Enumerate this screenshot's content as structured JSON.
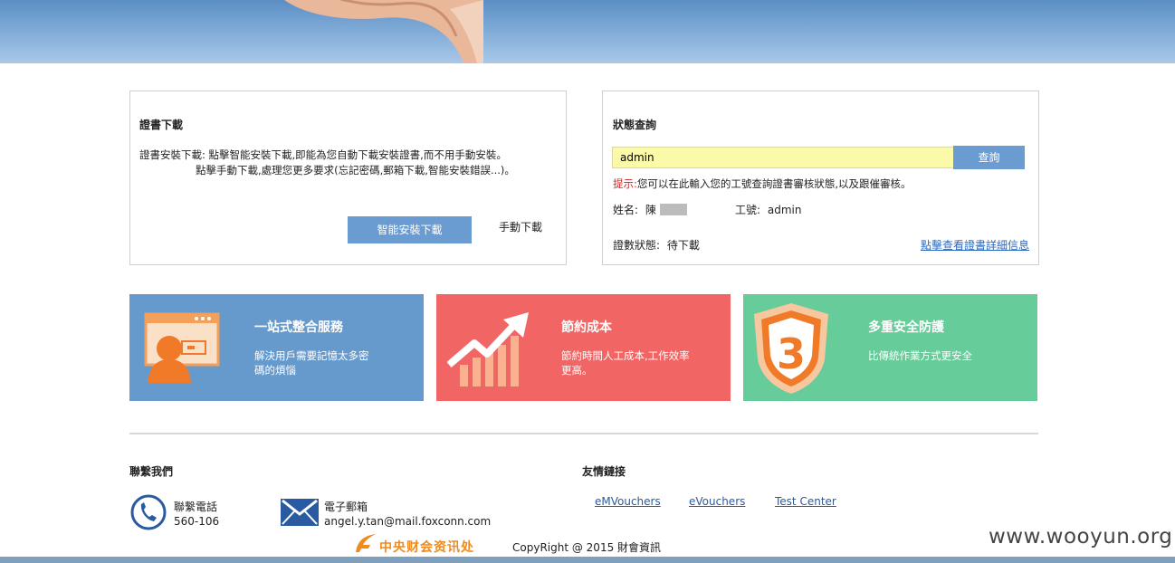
{
  "cert_download": {
    "title": "證書下載",
    "desc_line1": "證書安裝下載: 點擊智能安裝下載,即能為您自動下載安裝證書,而不用手動安裝。",
    "desc_line2": "點擊手動下載,處理您更多要求(忘記密碼,郵箱下載,智能安裝錯誤...)。",
    "smart_button": "智能安裝下載",
    "manual_link": "手動下載"
  },
  "status_query": {
    "title": "狀態查詢",
    "input_value": "admin",
    "query_button": "查詢",
    "tip_label": "提示:",
    "tip_text": "您可以在此輸入您的工號查詢證書審核狀態,以及跟催審核。",
    "name_label": "姓名:",
    "name_value": "陳",
    "empno_label": "工號:",
    "empno_value": "admin",
    "status_label": "證數狀態:",
    "status_value": "待下載",
    "detail_link": "點擊查看證書詳細信息"
  },
  "tiles": [
    {
      "title": "一站式整合服務",
      "desc": "解決用戶需要記憶太多密碼的煩惱",
      "color": "#6699cc",
      "icon": "user-screen-icon"
    },
    {
      "title": "節約成本",
      "desc": "節約時間人工成本,工作效率更高。",
      "color": "#f26565",
      "icon": "growth-chart-icon"
    },
    {
      "title": "多重安全防護",
      "desc": "比傳統作業方式更安全",
      "color": "#66cc99",
      "icon": "shield-3-icon"
    }
  ],
  "footer": {
    "contact_title": "聯繫我們",
    "phone_label": "聯繫電話",
    "phone_value": "560-106",
    "email_label": "電子郵箱",
    "email_value": "angel.y.tan@mail.foxconn.com",
    "links_title": "友情鏈接",
    "links": [
      "eMVouchers",
      "eVouchers",
      "Test Center"
    ],
    "logo_text": "中央财会资讯处",
    "copyright": "CopyRight @ 2015 財會資訊"
  },
  "watermark": "www.wooyun.org"
}
